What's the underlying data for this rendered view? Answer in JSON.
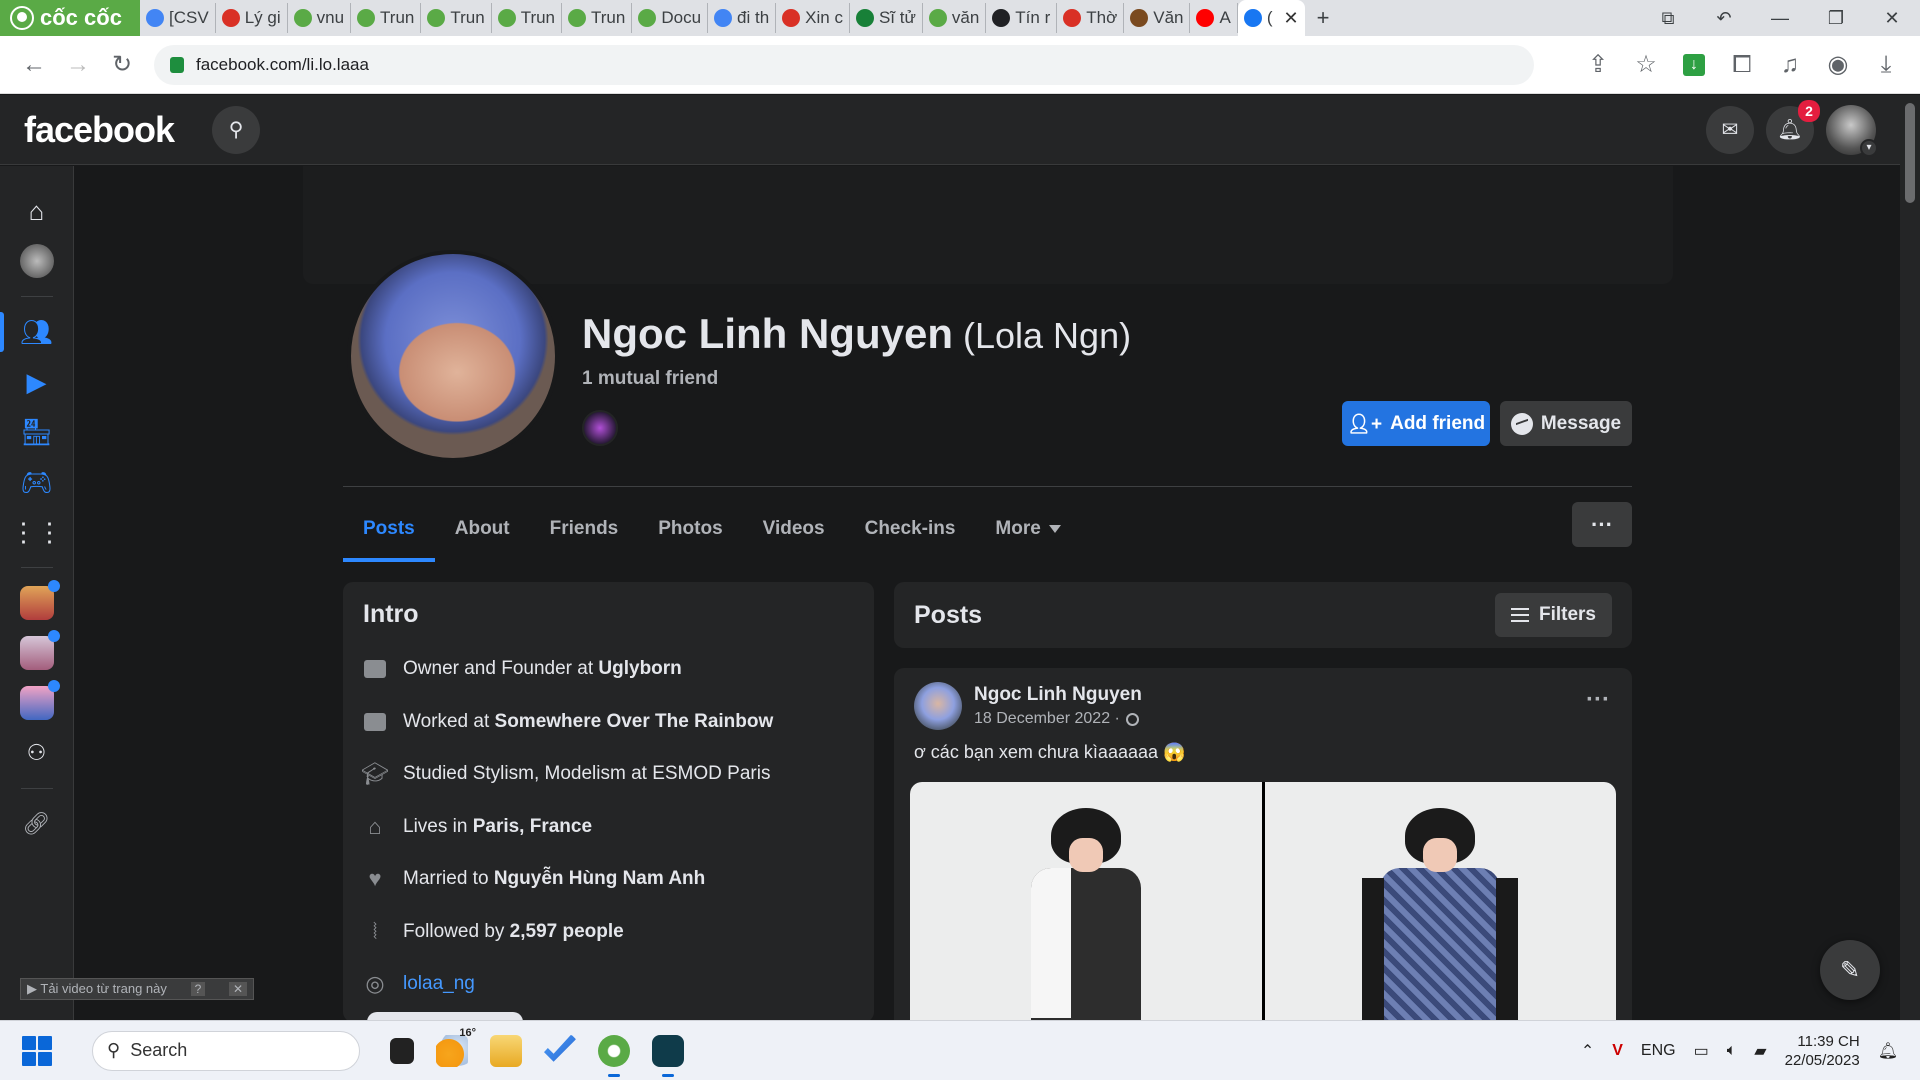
{
  "browser": {
    "brand": "cốc cốc",
    "tabs": [
      {
        "label": "[CSV",
        "color": "#4285f4"
      },
      {
        "label": "Lý gi",
        "color": "#d93025"
      },
      {
        "label": "vnu",
        "color": "#5aaa46"
      },
      {
        "label": "Trun",
        "color": "#5aaa46"
      },
      {
        "label": "Trun",
        "color": "#5aaa46"
      },
      {
        "label": "Trun",
        "color": "#5aaa46"
      },
      {
        "label": "Trun",
        "color": "#5aaa46"
      },
      {
        "label": "Docu",
        "color": "#5aaa46"
      },
      {
        "label": "đi th",
        "color": "#4285f4"
      },
      {
        "label": "Xin c",
        "color": "#d93025"
      },
      {
        "label": "Sĩ tử",
        "color": "#188038"
      },
      {
        "label": "văn",
        "color": "#5aaa46"
      },
      {
        "label": "Tín r",
        "color": "#202124"
      },
      {
        "label": "Thờ",
        "color": "#d93025"
      },
      {
        "label": "Văn",
        "color": "#7a4a1f"
      },
      {
        "label": "A",
        "color": "#ff0000"
      },
      {
        "label": "(",
        "color": "#1877f2"
      }
    ],
    "url": "facebook.com/li.lo.laaa"
  },
  "fb": {
    "logo": "facebook",
    "notifications_count": "2",
    "profile": {
      "name": "Ngoc Linh Nguyen",
      "alt_name": "(Lola Ngn)",
      "mutual": "1 mutual friend",
      "add_friend": "Add friend",
      "message": "Message"
    },
    "tabs": [
      "Posts",
      "About",
      "Friends",
      "Photos",
      "Videos",
      "Check-ins",
      "More"
    ],
    "more_options": "···",
    "intro": {
      "title": "Intro",
      "rows": [
        {
          "prefix": "Owner and Founder at ",
          "bold": "Uglyborn"
        },
        {
          "prefix": "Worked at ",
          "bold": "Somewhere Over The Rainbow"
        },
        {
          "prefix": "Studied Stylism, Modelism at ESMOD Paris",
          "bold": ""
        },
        {
          "prefix": "Lives in ",
          "bold": "Paris, France"
        },
        {
          "prefix": "Married to ",
          "bold": "Nguyễn Hùng Nam Anh"
        },
        {
          "prefix": "Followed by ",
          "bold": "2,597 people"
        }
      ],
      "instagram": "lolaa_ng"
    },
    "posts_header": {
      "title": "Posts",
      "filters": "Filters"
    },
    "post": {
      "author": "Ngoc Linh Nguyen",
      "date": "18 December 2022 ·",
      "text": "ơ các bạn xem chưa kìaaaaaa 😱",
      "more": "···"
    },
    "video_overlay": "▶ Tải video từ trang này"
  },
  "taskbar": {
    "search_placeholder": "Search",
    "weather": "16°",
    "lang": "ENG",
    "time": "11:39 CH",
    "date": "22/05/2023"
  }
}
